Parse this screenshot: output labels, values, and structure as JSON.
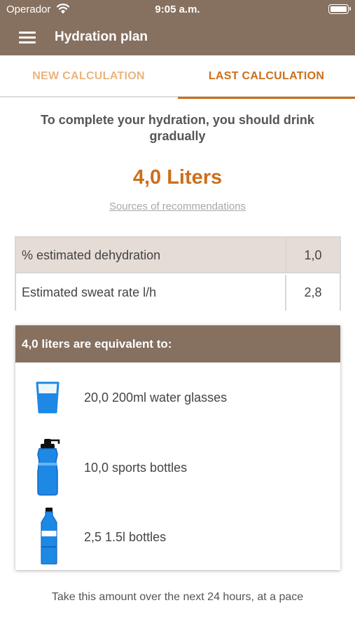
{
  "status": {
    "carrier": "Operador",
    "time": "9:05 a.m."
  },
  "header": {
    "title": "Hydration plan"
  },
  "tabs": [
    {
      "label": "NEW CALCULATION",
      "active": false
    },
    {
      "label": "LAST CALCULATION",
      "active": true
    }
  ],
  "result": {
    "intro": "To complete your hydration, you should drink gradually",
    "amount": "4,0 Liters",
    "sources_link": "Sources of recommendations"
  },
  "stats": [
    {
      "label": "% estimated dehydration",
      "value": "1,0"
    },
    {
      "label": "Estimated sweat rate l/h",
      "value": "2,8"
    }
  ],
  "equivalents": {
    "heading": "4,0 liters are equivalent to:",
    "items": [
      {
        "icon": "water-glass-icon",
        "text": "20,0 200ml water glasses"
      },
      {
        "icon": "sports-bottle-icon",
        "text": "10,0 sports bottles"
      },
      {
        "icon": "plastic-bottle-icon",
        "text": "2,5 1.5l bottles"
      }
    ]
  },
  "footer": {
    "note": "Take this amount over the next 24 hours, at a pace"
  },
  "colors": {
    "brand": "#86705f",
    "accent": "#cc6f1b",
    "accent_light": "#eab57d",
    "water": "#1e88e5"
  }
}
